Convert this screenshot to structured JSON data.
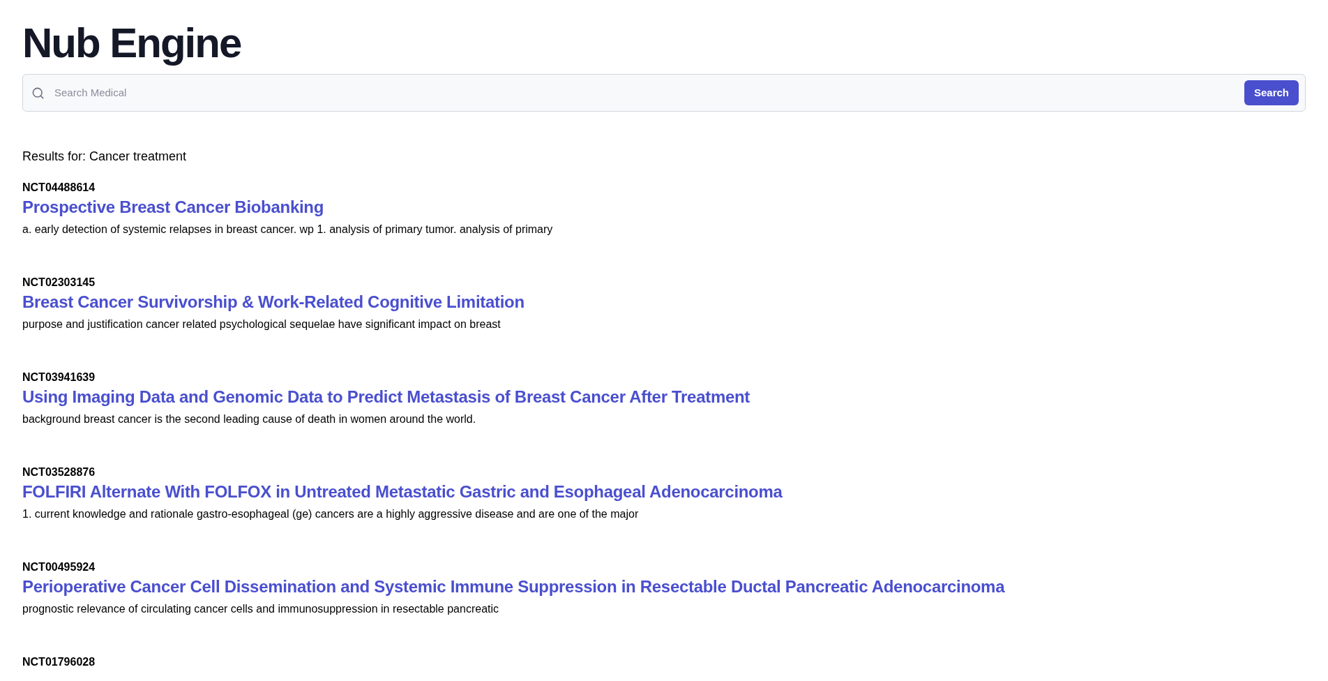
{
  "title": "Nub Engine",
  "search": {
    "placeholder": "Search Medical",
    "button": "Search"
  },
  "results_heading": "Results for: Cancer treatment",
  "results": [
    {
      "id": "NCT04488614",
      "title": "Prospective Breast Cancer Biobanking",
      "snippet": "a. early detection of systemic relapses in breast cancer. wp 1. analysis of primary tumor. analysis of primary"
    },
    {
      "id": "NCT02303145",
      "title": "Breast Cancer Survivorship & Work-Related Cognitive Limitation",
      "snippet": "purpose and justification cancer related psychological sequelae have significant impact on breast"
    },
    {
      "id": "NCT03941639",
      "title": "Using Imaging Data and Genomic Data to Predict Metastasis of Breast Cancer After Treatment",
      "snippet": "background breast cancer is the second leading cause of death in women around the world."
    },
    {
      "id": "NCT03528876",
      "title": "FOLFIRI Alternate With FOLFOX in Untreated Metastatic Gastric and Esophageal Adenocarcinoma",
      "snippet": "1. current knowledge and rationale gastro-esophageal (ge) cancers are a highly aggressive disease and are one of the major"
    },
    {
      "id": "NCT00495924",
      "title": "Perioperative Cancer Cell Dissemination and Systemic Immune Suppression in Resectable Ductal Pancreatic Adenocarcinoma",
      "snippet": "prognostic relevance of circulating cancer cells and immunosuppression in resectable pancreatic"
    },
    {
      "id": "NCT01796028"
    }
  ]
}
